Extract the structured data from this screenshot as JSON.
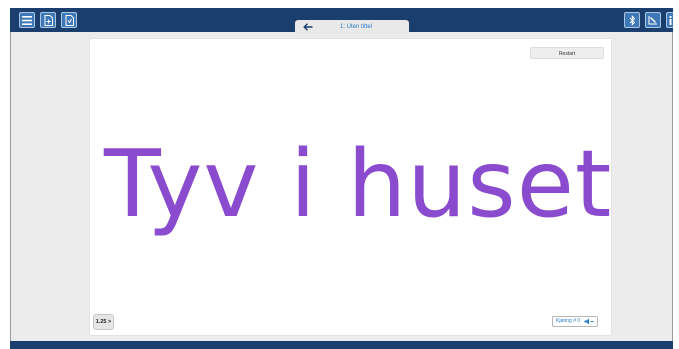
{
  "colors": {
    "topbar": "#1a3f6f",
    "button": "#3f78b6",
    "accent_text": "#8a4bce",
    "link": "#2a7cc4"
  },
  "toolbar": {
    "left_icons": [
      "menu-icon",
      "add-page-icon",
      "document-icon"
    ],
    "right_icons": [
      "bluetooth-icon",
      "edit-mode-icon",
      "info-icon"
    ]
  },
  "tab": {
    "title": "1: Uten tittel",
    "back_icon": "arrow-left-icon"
  },
  "canvas": {
    "restart_label": "Restart",
    "main_text": "Tyv i huset",
    "speed_label": "1.25 >",
    "counter_label": "Kjøring # 0",
    "counter_icon": "speaker-icon"
  }
}
